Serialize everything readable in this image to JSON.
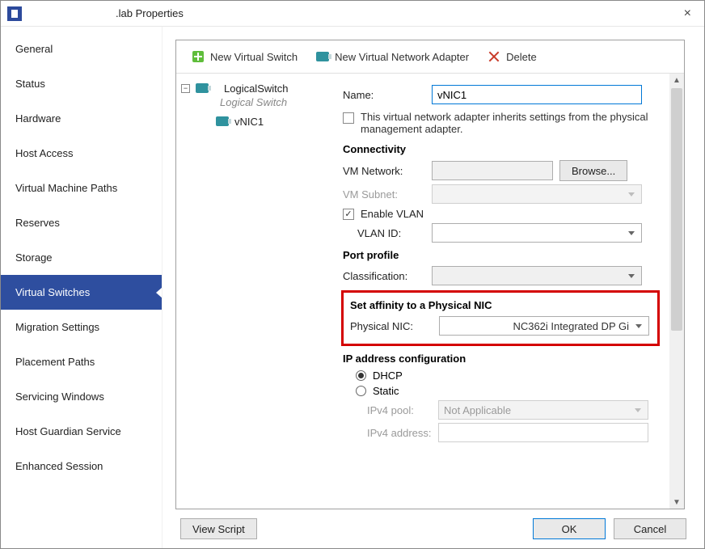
{
  "window": {
    "title": ".lab Properties"
  },
  "nav": {
    "items": [
      {
        "label": "General"
      },
      {
        "label": "Status"
      },
      {
        "label": "Hardware"
      },
      {
        "label": "Host Access"
      },
      {
        "label": "Virtual Machine Paths"
      },
      {
        "label": "Reserves"
      },
      {
        "label": "Storage"
      },
      {
        "label": "Virtual Switches",
        "selected": true
      },
      {
        "label": "Migration Settings"
      },
      {
        "label": "Placement Paths"
      },
      {
        "label": "Servicing Windows"
      },
      {
        "label": "Host Guardian Service"
      },
      {
        "label": "Enhanced Session"
      }
    ]
  },
  "toolbar": {
    "new_switch": "New Virtual Switch",
    "new_adapter": "New Virtual Network Adapter",
    "delete": "Delete"
  },
  "tree": {
    "root_label": "LogicalSwitch",
    "root_sub": "Logical Switch",
    "child_label": "vNIC1"
  },
  "form": {
    "name_label": "Name:",
    "name_value": "vNIC1",
    "inherit_text": "This virtual network adapter inherits settings from the physical management adapter.",
    "connectivity_header": "Connectivity",
    "vm_network_label": "VM Network:",
    "browse_label": "Browse...",
    "vm_subnet_label": "VM Subnet:",
    "enable_vlan_label": "Enable VLAN",
    "vlan_id_label": "VLAN ID:",
    "port_profile_header": "Port profile",
    "classification_label": "Classification:",
    "affinity_header": "Set affinity to a Physical NIC",
    "physical_nic_label": "Physical NIC:",
    "physical_nic_value": "NC362i Integrated DP Gi",
    "ip_config_header": "IP address configuration",
    "dhcp_label": "DHCP",
    "static_label": "Static",
    "ipv4_pool_label": "IPv4 pool:",
    "ipv4_pool_value": "Not Applicable",
    "ipv4_addr_label": "IPv4 address:"
  },
  "footer": {
    "view_script": "View Script",
    "ok": "OK",
    "cancel": "Cancel"
  }
}
